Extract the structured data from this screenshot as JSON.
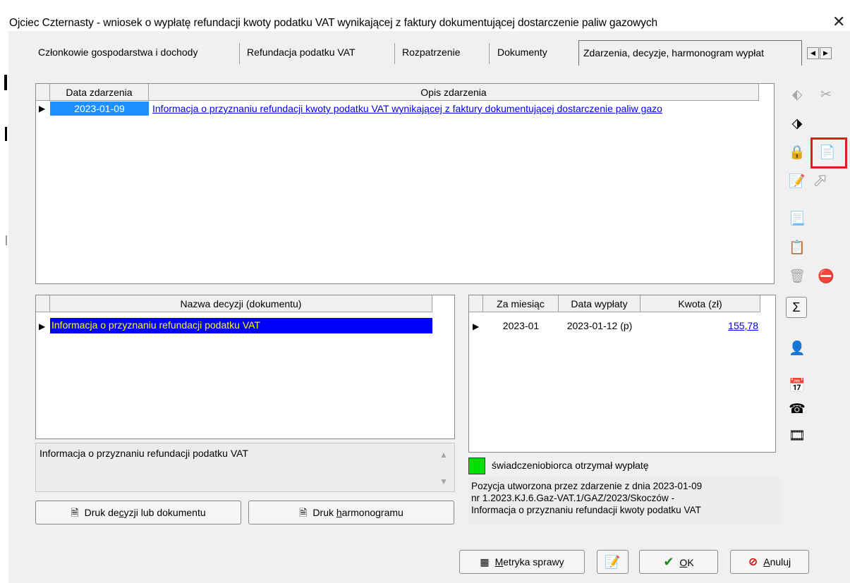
{
  "window": {
    "title": "Ojciec Czternasty - wniosek o wypłatę refundacji kwoty podatku VAT wynikającej z faktury dokumentującej dostarczenie paliw gazowych",
    "close_glyph": "✕"
  },
  "tabs": [
    {
      "label": "Członkowie gospodarstwa i dochody"
    },
    {
      "label": "Refundacja podatku VAT"
    },
    {
      "label": "Rozpatrzenie"
    },
    {
      "label": "Dokumenty"
    },
    {
      "label": "Zdarzenia, decyzje, harmonogram wypłat"
    }
  ],
  "events_grid": {
    "headers": [
      "Data zdarzenia",
      "Opis zdarzenia"
    ],
    "rows": [
      {
        "date": "2023-01-09",
        "description": "Informacja o przyznaniu refundacji kwoty podatku VAT wynikającej z faktury dokumentującej dostarczenie paliw gazo"
      }
    ]
  },
  "decisions_grid": {
    "headers": [
      "Nazwa decyzji (dokumentu)"
    ],
    "rows": [
      {
        "name": "Informacja o przyznaniu refundacji podatku VAT"
      }
    ]
  },
  "memo_text": "Informacja o przyznaniu refundacji podatku VAT",
  "payments_grid": {
    "headers": [
      "Za miesiąc",
      "Data wypłaty",
      "Kwota (zł)"
    ],
    "rows": [
      {
        "month": "2023-01",
        "pay_date": "2023-01-12 (p)",
        "amount": "155,78"
      }
    ]
  },
  "legend": {
    "text": "świadczeniobiorca otrzymał wypłatę",
    "color": "#00e000"
  },
  "position_info": [
    "Pozycja utworzona przez zdarzenie z dnia 2023-01-09",
    "nr 1.2023.KJ.6.Gaz-VAT.1/GAZ/2023/Skoczów -",
    "Informacja o przyznaniu refundacji kwoty podatku VAT"
  ],
  "buttons": {
    "print_decision_pre": "Druk de",
    "print_decision_u": "c",
    "print_decision_post": "yzji lub dokumentu",
    "print_schedule_pre": "Druk ",
    "print_schedule_u": "h",
    "print_schedule_post": "armonogramu",
    "metryka_u": "M",
    "metryka_post": "etryka sprawy",
    "ok_u": "O",
    "ok_post": "K",
    "cancel_u": "A",
    "cancel_post": "nuluj"
  },
  "toolbar_icons": [
    "tag-icon",
    "scissors-tag-icon",
    "label-icon",
    "lock-icon",
    "document-copy-icon",
    "calendar-pencil-icon",
    "new-document-icon",
    "document-icon",
    "trash-icon",
    "forbidden-icon",
    "sum-icon",
    "person-document-icon",
    "calendar-icon",
    "phone-icon",
    "film-icon"
  ],
  "colors": {
    "selection": "#0000ff",
    "selection_text": "#ffff00",
    "date_highlight": "#1e90ff",
    "link": "#0000ee",
    "highlight_box": "#e21b1b"
  }
}
